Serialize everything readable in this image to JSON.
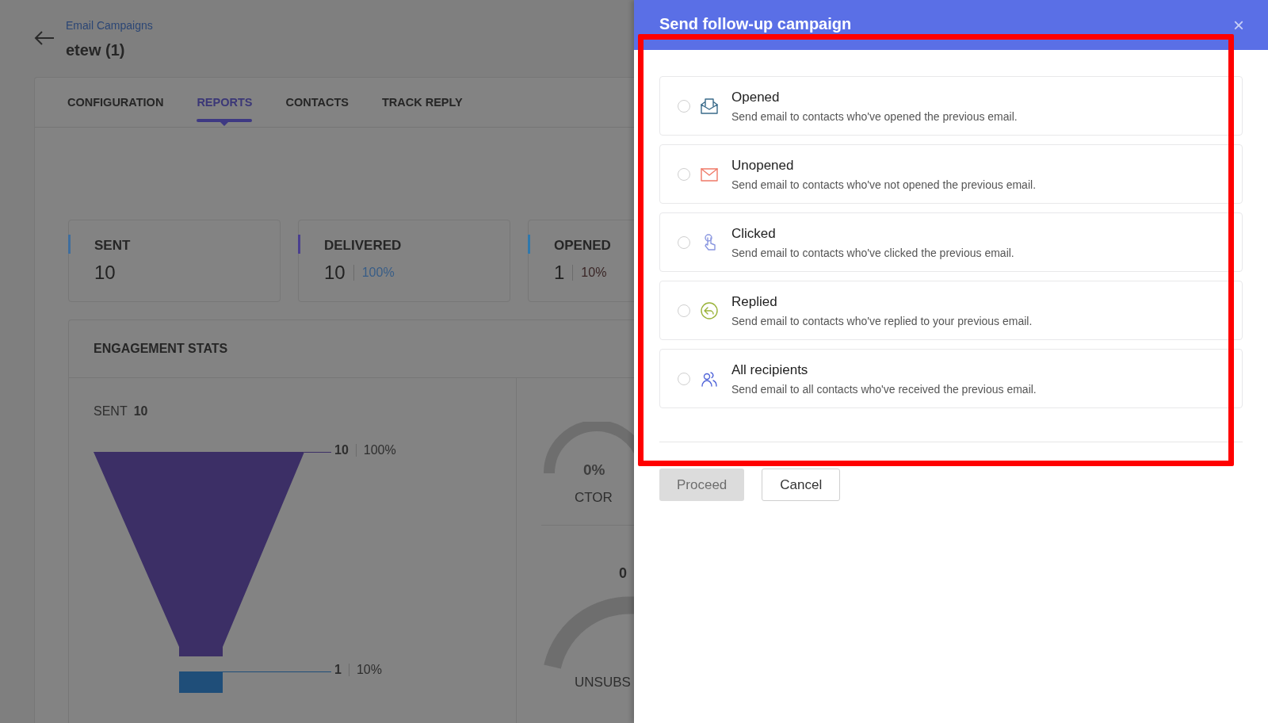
{
  "breadcrumb": "Email Campaigns",
  "title": "etew (1)",
  "tabs": [
    {
      "label": "CONFIGURATION",
      "selected": false
    },
    {
      "label": "REPORTS",
      "selected": true
    },
    {
      "label": "CONTACTS",
      "selected": false
    },
    {
      "label": "TRACK REPLY",
      "selected": false
    }
  ],
  "stats": [
    {
      "label": "SENT",
      "value": "10",
      "color": "#3f6e9e"
    },
    {
      "label": "DELIVERED",
      "value": "10",
      "percent": "100%",
      "color": "#4a3f8f"
    },
    {
      "label": "OPENED",
      "value": "1",
      "percent": "10%",
      "color": "#2f78ad"
    }
  ],
  "engagement": {
    "title": "ENGAGEMENT STATS",
    "sent_label": "SENT",
    "sent_value": "10",
    "funnel": [
      {
        "value": "10",
        "percent": "100%"
      },
      {
        "value": "1",
        "percent": "10%"
      }
    ],
    "gauges": [
      {
        "value": "0%",
        "label": "CTOR"
      },
      {
        "value": "0",
        "label": "UNSUBS"
      }
    ]
  },
  "dialog": {
    "title": "Send follow-up campaign",
    "close": "×",
    "options": [
      {
        "kind": "opened",
        "label": "Opened",
        "description": "Send email to contacts who've opened the previous email.",
        "selected": false
      },
      {
        "kind": "unopened",
        "label": "Unopened",
        "description": "Send email to contacts who've not opened the previous email.",
        "selected": false
      },
      {
        "kind": "clicked",
        "label": "Clicked",
        "description": "Send email to contacts who've clicked the previous email.",
        "selected": false
      },
      {
        "kind": "replied",
        "label": "Replied",
        "description": "Send email to contacts who've replied to your previous email.",
        "selected": false
      },
      {
        "kind": "all",
        "label": "All recipients",
        "description": "Send email to all contacts who've received the previous email.",
        "selected": false
      }
    ],
    "buttons": [
      {
        "label": "Proceed",
        "disabled": true
      },
      {
        "label": "Cancel",
        "disabled": false
      }
    ]
  }
}
